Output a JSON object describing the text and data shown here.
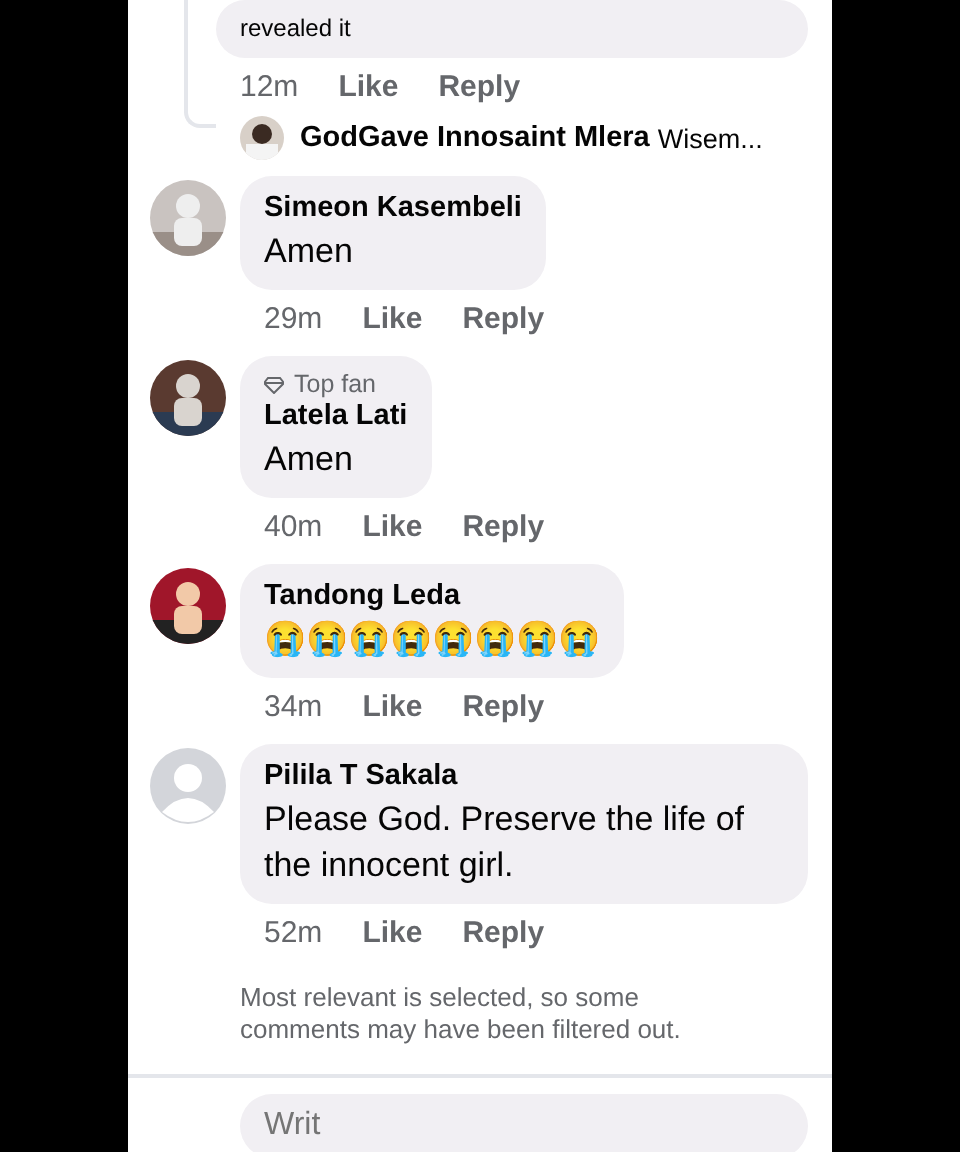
{
  "top_comment": {
    "body": "revealed it",
    "time": "12m",
    "like": "Like",
    "reply": "Reply"
  },
  "reply_preview": {
    "name": "GodGave Innosaint Mlera",
    "snippet": "Wisem..."
  },
  "comments": [
    {
      "name": "Simeon Kasembeli",
      "body": "Amen",
      "time": "29m",
      "like": "Like",
      "reply": "Reply"
    },
    {
      "badge": "Top fan",
      "name": "Latela Lati",
      "body": "Amen",
      "time": "40m",
      "like": "Like",
      "reply": "Reply"
    },
    {
      "name": "Tandong Leda",
      "body": "😭😭😭😭😭😭😭😭",
      "time": "34m",
      "like": "Like",
      "reply": "Reply"
    },
    {
      "kind": "default",
      "name": "Pilila T Sakala",
      "body": "Please God. Preserve the life of the innocent girl.",
      "time": "52m",
      "like": "Like",
      "reply": "Reply"
    }
  ],
  "filter_note": "Most relevant is selected, so some comments may have been filtered out.",
  "composer": {
    "placeholder": "Writ"
  }
}
